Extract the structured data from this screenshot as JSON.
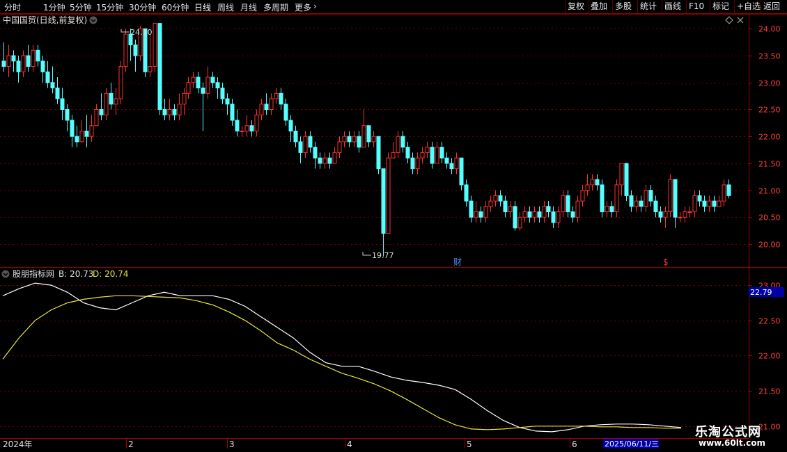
{
  "toolbar": {
    "periods": [
      "分时",
      "1分钟",
      "5分钟",
      "15分钟",
      "30分钟",
      "60分钟",
      "日线",
      "周线",
      "月线",
      "多周期",
      "更多"
    ],
    "active_period": "日线",
    "buttons": [
      "复权",
      "叠加",
      "多股",
      "统计",
      "画线",
      "F10",
      "标记",
      "+自选",
      "返回"
    ]
  },
  "main_panel": {
    "title": "中国国贸(日线,前复权)",
    "high_label": "24.10",
    "low_label": "19.77",
    "marker_cai": "财",
    "marker_s": "$",
    "colors": {
      "up": "#ff3030",
      "down": "#54ffff"
    }
  },
  "indicator_panel": {
    "name": "股朋指标网",
    "b_label": "B: 20.73",
    "d_label": "D: 20.74",
    "current_value": "22.79",
    "colors": {
      "B": "#ffffff",
      "D": "#e8e83a"
    }
  },
  "x_axis": {
    "year_label": "2024年",
    "months": [
      "2",
      "3",
      "4",
      "5",
      "6"
    ],
    "cursor_date": "2025/06/11/三"
  },
  "watermark": {
    "line1": "乐淘公式网",
    "line2": "www.60lt.com"
  },
  "chart_data": [
    {
      "type": "candlestick",
      "title": "中国国贸(日线,前复权)",
      "ylim": [
        19.6,
        24.25
      ],
      "y_ticks": [
        "24.00",
        "23.50",
        "23.00",
        "22.50",
        "22.00",
        "21.50",
        "21.00",
        "20.50",
        "20.00"
      ],
      "annotations": [
        {
          "text": "24.10",
          "type": "high"
        },
        {
          "text": "19.77",
          "type": "low"
        }
      ],
      "candles": [
        [
          23.4,
          23.3,
          23.75,
          23.2
        ],
        [
          23.3,
          23.5,
          23.7,
          23.1
        ],
        [
          23.5,
          23.4,
          23.6,
          23.2
        ],
        [
          23.4,
          23.2,
          23.5,
          23.0
        ],
        [
          23.2,
          23.5,
          23.6,
          23.1
        ],
        [
          23.5,
          23.3,
          23.7,
          23.2
        ],
        [
          23.3,
          23.6,
          23.7,
          23.2
        ],
        [
          23.6,
          23.4,
          23.7,
          23.3
        ],
        [
          23.4,
          23.2,
          23.5,
          23.0
        ],
        [
          23.2,
          23.0,
          23.4,
          22.9
        ],
        [
          23.0,
          22.9,
          23.3,
          22.8
        ],
        [
          22.9,
          22.7,
          23.1,
          22.6
        ],
        [
          22.7,
          22.5,
          22.9,
          22.3
        ],
        [
          22.5,
          22.3,
          22.6,
          22.1
        ],
        [
          22.3,
          22.0,
          22.4,
          21.8
        ],
        [
          22.0,
          21.9,
          22.2,
          21.8
        ],
        [
          21.9,
          22.1,
          22.3,
          21.9
        ],
        [
          22.1,
          22.0,
          22.4,
          21.8
        ],
        [
          22.0,
          22.2,
          22.4,
          21.9
        ],
        [
          22.2,
          22.5,
          22.6,
          22.2
        ],
        [
          22.5,
          22.4,
          22.8,
          22.3
        ],
        [
          22.4,
          22.8,
          22.9,
          22.3
        ],
        [
          22.8,
          22.6,
          23.0,
          22.5
        ],
        [
          22.6,
          22.7,
          22.9,
          22.4
        ],
        [
          22.7,
          23.3,
          23.4,
          22.6
        ],
        [
          23.3,
          23.9,
          24.0,
          23.2
        ],
        [
          23.9,
          23.7,
          24.0,
          23.4
        ],
        [
          23.7,
          23.5,
          23.8,
          23.2
        ],
        [
          23.5,
          24.0,
          24.05,
          23.4
        ],
        [
          24.0,
          23.2,
          24.0,
          23.1
        ],
        [
          23.2,
          23.3,
          23.9,
          23.1
        ],
        [
          23.3,
          24.1,
          24.1,
          23.2
        ],
        [
          24.1,
          22.5,
          24.1,
          22.4
        ],
        [
          22.5,
          22.4,
          22.7,
          22.3
        ],
        [
          22.4,
          22.5,
          22.7,
          22.3
        ],
        [
          22.5,
          22.4,
          22.6,
          22.3
        ],
        [
          22.4,
          22.6,
          22.8,
          22.3
        ],
        [
          22.6,
          22.8,
          22.9,
          22.4
        ],
        [
          22.8,
          23.0,
          23.1,
          22.7
        ],
        [
          23.0,
          23.1,
          23.2,
          22.9
        ],
        [
          23.1,
          22.9,
          23.2,
          22.8
        ],
        [
          22.9,
          22.8,
          23.0,
          22.1
        ],
        [
          22.8,
          23.1,
          23.3,
          22.7
        ],
        [
          23.1,
          23.0,
          23.2,
          22.9
        ],
        [
          23.0,
          22.9,
          23.1,
          22.7
        ],
        [
          22.9,
          22.7,
          23.0,
          22.6
        ],
        [
          22.7,
          22.6,
          22.8,
          22.4
        ],
        [
          22.6,
          22.3,
          22.7,
          22.2
        ],
        [
          22.3,
          22.1,
          22.5,
          22.0
        ],
        [
          22.1,
          22.1,
          22.2,
          22.0
        ],
        [
          22.1,
          22.2,
          22.4,
          22.0
        ],
        [
          22.2,
          22.1,
          22.3,
          22.0
        ],
        [
          22.1,
          22.4,
          22.5,
          22.0
        ],
        [
          22.4,
          22.6,
          22.7,
          22.3
        ],
        [
          22.6,
          22.5,
          22.8,
          22.4
        ],
        [
          22.5,
          22.7,
          22.8,
          22.4
        ],
        [
          22.7,
          22.8,
          22.9,
          22.6
        ],
        [
          22.8,
          22.6,
          22.9,
          22.5
        ],
        [
          22.6,
          22.3,
          22.7,
          22.2
        ],
        [
          22.3,
          22.1,
          22.4,
          21.9
        ],
        [
          22.1,
          21.9,
          22.2,
          21.8
        ],
        [
          21.9,
          21.7,
          22.0,
          21.5
        ],
        [
          21.7,
          22.0,
          22.1,
          21.6
        ],
        [
          22.0,
          21.8,
          22.1,
          21.7
        ],
        [
          21.8,
          21.6,
          21.9,
          21.4
        ],
        [
          21.6,
          21.5,
          21.7,
          21.4
        ],
        [
          21.5,
          21.6,
          21.7,
          21.4
        ],
        [
          21.6,
          21.5,
          21.7,
          21.4
        ],
        [
          21.5,
          21.7,
          21.8,
          21.5
        ],
        [
          21.7,
          21.9,
          22.0,
          21.6
        ],
        [
          21.9,
          22.0,
          22.1,
          21.8
        ],
        [
          22.0,
          21.9,
          22.1,
          21.8
        ],
        [
          21.9,
          22.0,
          22.1,
          21.8
        ],
        [
          22.0,
          21.8,
          22.1,
          21.7
        ],
        [
          21.8,
          22.2,
          22.5,
          21.8
        ],
        [
          22.2,
          21.9,
          22.2,
          21.8
        ],
        [
          21.9,
          22.0,
          22.1,
          21.8
        ],
        [
          22.0,
          21.4,
          22.0,
          21.3
        ],
        [
          21.4,
          20.2,
          21.4,
          19.77
        ],
        [
          20.2,
          21.6,
          21.7,
          20.2
        ],
        [
          21.6,
          21.7,
          21.9,
          21.6
        ],
        [
          21.7,
          22.0,
          22.1,
          21.6
        ],
        [
          22.0,
          21.8,
          22.1,
          21.7
        ],
        [
          21.8,
          21.6,
          21.9,
          21.5
        ],
        [
          21.6,
          21.4,
          21.7,
          21.3
        ],
        [
          21.4,
          21.6,
          21.7,
          21.3
        ],
        [
          21.6,
          21.7,
          21.8,
          21.5
        ],
        [
          21.7,
          21.8,
          21.9,
          21.6
        ],
        [
          21.8,
          21.5,
          21.9,
          21.4
        ],
        [
          21.5,
          21.8,
          21.9,
          21.5
        ],
        [
          21.8,
          21.6,
          21.9,
          21.5
        ],
        [
          21.6,
          21.5,
          21.7,
          21.4
        ],
        [
          21.5,
          21.4,
          21.6,
          21.3
        ],
        [
          21.4,
          21.6,
          21.7,
          21.3
        ],
        [
          21.6,
          21.1,
          21.6,
          21.0
        ],
        [
          21.1,
          20.8,
          21.2,
          20.7
        ],
        [
          20.8,
          20.5,
          20.9,
          20.4
        ],
        [
          20.5,
          20.6,
          20.8,
          20.4
        ],
        [
          20.6,
          20.5,
          20.7,
          20.4
        ],
        [
          20.5,
          20.7,
          20.8,
          20.4
        ],
        [
          20.7,
          20.8,
          20.9,
          20.6
        ],
        [
          20.8,
          20.9,
          21.0,
          20.7
        ],
        [
          20.9,
          20.8,
          21.0,
          20.7
        ],
        [
          20.8,
          20.6,
          20.9,
          20.5
        ],
        [
          20.6,
          20.7,
          20.8,
          20.5
        ],
        [
          20.7,
          20.3,
          20.8,
          20.25
        ],
        [
          20.3,
          20.5,
          20.6,
          20.25
        ],
        [
          20.5,
          20.6,
          20.7,
          20.4
        ],
        [
          20.6,
          20.5,
          20.7,
          20.4
        ],
        [
          20.5,
          20.6,
          20.7,
          20.4
        ],
        [
          20.6,
          20.5,
          20.7,
          20.4
        ],
        [
          20.5,
          20.7,
          20.8,
          20.4
        ],
        [
          20.7,
          20.6,
          20.8,
          20.5
        ],
        [
          20.6,
          20.4,
          20.7,
          20.3
        ],
        [
          20.4,
          20.6,
          20.7,
          20.3
        ],
        [
          20.6,
          20.9,
          21.0,
          20.5
        ],
        [
          20.9,
          20.6,
          21.0,
          20.5
        ],
        [
          20.6,
          20.5,
          20.7,
          20.4
        ],
        [
          20.5,
          20.8,
          20.9,
          20.4
        ],
        [
          20.8,
          21.0,
          21.1,
          20.7
        ],
        [
          21.0,
          21.1,
          21.3,
          20.9
        ],
        [
          21.1,
          21.2,
          21.3,
          21.0
        ],
        [
          21.2,
          21.1,
          21.3,
          21.0
        ],
        [
          21.1,
          20.6,
          21.2,
          20.5
        ],
        [
          20.6,
          20.7,
          20.8,
          20.5
        ],
        [
          20.7,
          20.6,
          20.8,
          20.5
        ],
        [
          20.6,
          21.1,
          21.2,
          20.5
        ],
        [
          21.1,
          21.5,
          21.5,
          20.9
        ],
        [
          21.5,
          20.9,
          21.5,
          20.8
        ],
        [
          20.9,
          20.7,
          21.0,
          20.6
        ],
        [
          20.7,
          20.8,
          20.9,
          20.6
        ],
        [
          20.8,
          20.7,
          20.9,
          20.6
        ],
        [
          20.7,
          21.0,
          21.1,
          20.6
        ],
        [
          21.0,
          20.8,
          21.1,
          20.7
        ],
        [
          20.8,
          20.6,
          20.9,
          20.5
        ],
        [
          20.6,
          20.5,
          20.7,
          20.4
        ],
        [
          20.5,
          20.6,
          20.7,
          20.3
        ],
        [
          20.6,
          21.2,
          21.3,
          20.5
        ],
        [
          21.2,
          20.5,
          21.2,
          20.3
        ],
        [
          20.5,
          20.5,
          20.6,
          20.4
        ],
        [
          20.5,
          20.6,
          20.7,
          20.4
        ],
        [
          20.6,
          20.6,
          20.7,
          20.5
        ],
        [
          20.6,
          20.9,
          21.0,
          20.5
        ],
        [
          20.9,
          20.8,
          21.0,
          20.7
        ],
        [
          20.8,
          20.7,
          20.9,
          20.6
        ],
        [
          20.7,
          20.8,
          20.9,
          20.6
        ],
        [
          20.8,
          20.7,
          20.9,
          20.6
        ],
        [
          20.7,
          20.8,
          20.9,
          20.7
        ],
        [
          20.8,
          21.1,
          21.2,
          20.7
        ],
        [
          21.1,
          20.9,
          21.2,
          20.85
        ]
      ]
    },
    {
      "type": "line",
      "title": "股朋指标网",
      "ylim": [
        20.85,
        23.1
      ],
      "y_ticks": [
        "23.00",
        "22.50",
        "22.00",
        "21.50",
        "21.00"
      ],
      "series": [
        {
          "name": "B",
          "values": [
            22.85,
            22.95,
            23.03,
            23.0,
            22.9,
            22.75,
            22.68,
            22.65,
            22.75,
            22.85,
            22.9,
            22.85,
            22.85,
            22.85,
            22.8,
            22.7,
            22.55,
            22.4,
            22.25,
            22.05,
            21.9,
            21.85,
            21.85,
            21.78,
            21.7,
            21.65,
            21.62,
            21.58,
            21.52,
            21.38,
            21.22,
            21.08,
            20.98,
            20.93,
            20.92,
            20.95,
            21.0,
            21.02,
            21.03,
            21.03,
            21.02,
            21.0,
            20.98
          ]
        },
        {
          "name": "D",
          "values": [
            21.95,
            22.25,
            22.5,
            22.65,
            22.75,
            22.8,
            22.83,
            22.85,
            22.85,
            22.84,
            22.83,
            22.82,
            22.78,
            22.72,
            22.62,
            22.5,
            22.35,
            22.18,
            22.08,
            21.95,
            21.85,
            21.75,
            21.68,
            21.6,
            21.5,
            21.38,
            21.25,
            21.12,
            21.02,
            20.96,
            20.95,
            20.96,
            20.98,
            21.0,
            21.0,
            21.0,
            21.0,
            20.99,
            20.99,
            20.98,
            20.98,
            20.97,
            20.97
          ]
        }
      ]
    }
  ]
}
